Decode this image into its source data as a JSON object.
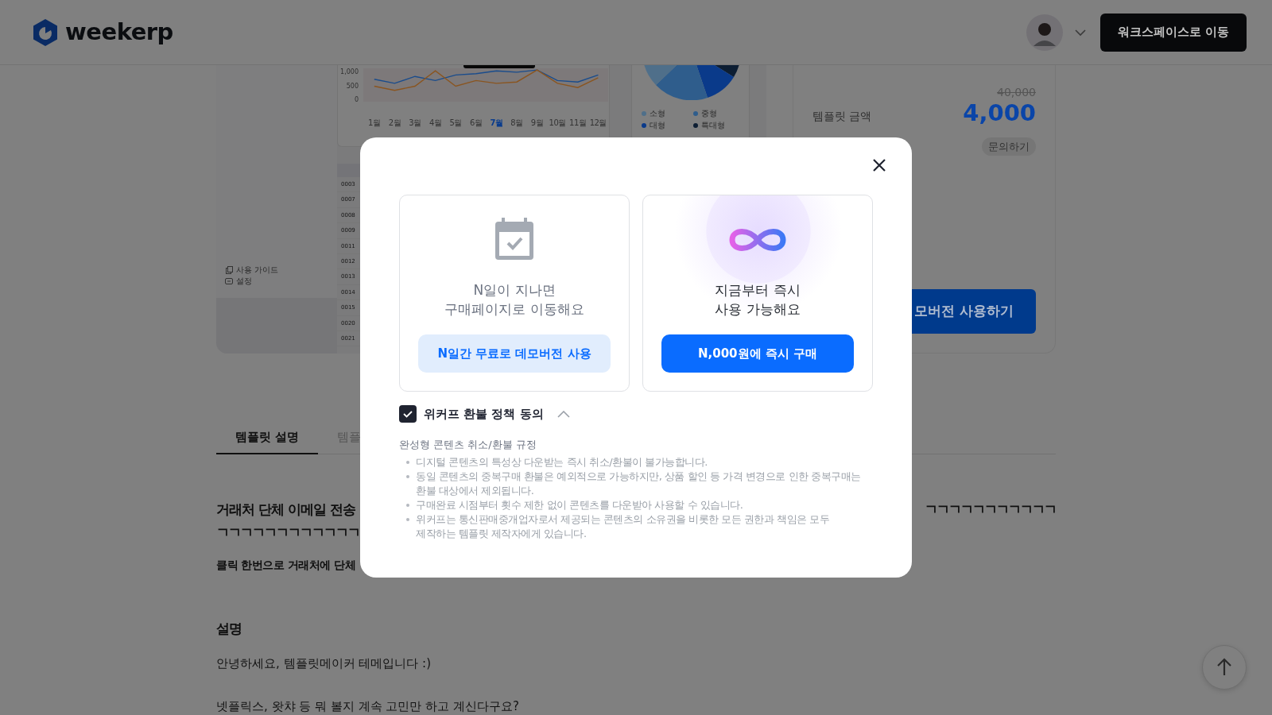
{
  "header": {
    "logo_text": "weekerp",
    "workspace_button": "워크스페이스로 이동"
  },
  "preview": {
    "chart": {
      "chart_data": {
        "type": "line",
        "categories": [
          "1월",
          "2월",
          "3월",
          "4월",
          "5월",
          "6월",
          "7월",
          "8월",
          "9월",
          "10월",
          "11월",
          "12월"
        ],
        "yticks": [
          0,
          500,
          {
            "value": 1000,
            "label": "1,000"
          }
        ],
        "series": [
          {
            "color": "#1a4c8c",
            "values": [
              750,
              600,
              850,
              700,
              900,
              950,
              1050,
              1000,
              1080,
              700,
              650,
              900
            ]
          },
          {
            "color": "#8a5520",
            "values": [
              500,
              350,
              500,
              1050,
              500,
              700,
              600,
              650,
              1080,
              600,
              450,
              800
            ]
          }
        ],
        "ylim": [
          0,
          1140
        ]
      },
      "x_label_states": [
        {
          "selected": false
        },
        {
          "selected": false
        },
        {
          "selected": false
        },
        {
          "selected": false
        },
        {
          "selected": false
        },
        {
          "selected": false
        },
        {
          "selected": true
        },
        {
          "selected": false
        },
        {
          "selected": false
        },
        {
          "selected": false
        },
        {
          "selected": false
        },
        {
          "selected": false
        }
      ]
    },
    "pie_legend": [
      {
        "label": "소형",
        "color": "#4f6f8a"
      },
      {
        "label": "중형",
        "color": "#2f5d8c"
      },
      {
        "label": "대형",
        "color": "#0a3a8a"
      },
      {
        "label": "특대형",
        "color": "#0d1e33"
      }
    ],
    "table_rows": [
      "0003",
      "0007",
      "0008",
      "0009",
      "0011",
      "0012",
      "0013",
      "0014",
      "0015",
      "0020",
      "0021"
    ],
    "sidebar_items": [
      "사용 가이드",
      "설정"
    ]
  },
  "price": {
    "original": "40,000",
    "price": "4,000",
    "label": "템플릿 금액",
    "inquiry_button": "문의하기",
    "demo_button": "모버전 사용하기"
  },
  "tabs": [
    {
      "label": "템플릿 설명",
      "selected": true
    },
    {
      "label": "템플",
      "selected": false
    }
  ],
  "content": {
    "title_start": "거래처 단체 이메일 전송",
    "title_end": "ㄱㄱㄱㄱㄱㄱㄱㄱㄱㄱㄱ",
    "title_line2": "ㄱㄱㄱㄱㄱㄱㄱㄱㄱㄱㄱㄱ",
    "subtitle": "클릭 한번으로 거래처에 단체",
    "section_title": "설명",
    "paragraphs": [
      "안녕하세요, 템플릿메이커 테메입니다 :)",
      "넷플릭스, 왓챠 등 뭐 볼지 계속 고민만 하고 계신다구요?"
    ]
  },
  "modal": {
    "options": [
      {
        "kind": "demo",
        "text": "N일이 지나면\n구매페이지로 이동해요",
        "button": "N일간 무료로 데모버전 사용"
      },
      {
        "kind": "buy",
        "text": "지금부터 즉시\n사용 가능해요",
        "button": "N,000원에 즉시 구매"
      }
    ],
    "agree": {
      "label": "위커프 환불 정책 동의",
      "checked": true,
      "expanded": true
    },
    "policy_title": "완성형 콘텐츠 취소/환불 규정",
    "policy_items": [
      "디지털 콘텐츠의 특성상 다운받는 즉시 취소/환불이 불가능합니다.",
      "동일 콘텐츠의 중복구매 환불은 예외적으로 가능하지만, 상품 할인 등 가격 변경으로 인한 중복구매는 환불 대상에서 제외됩니다.",
      "구매완료 시점부터 횟수 제한 없이 콘텐츠를 다운받아 사용할 수 있습니다.",
      "위커프는 통신판매중개업자로서 제공되는 콘텐츠의 소유권을 비롯한 모든 권한과 책임은 모두 제작하는 템플릿 제작자에게 있습니다."
    ]
  }
}
